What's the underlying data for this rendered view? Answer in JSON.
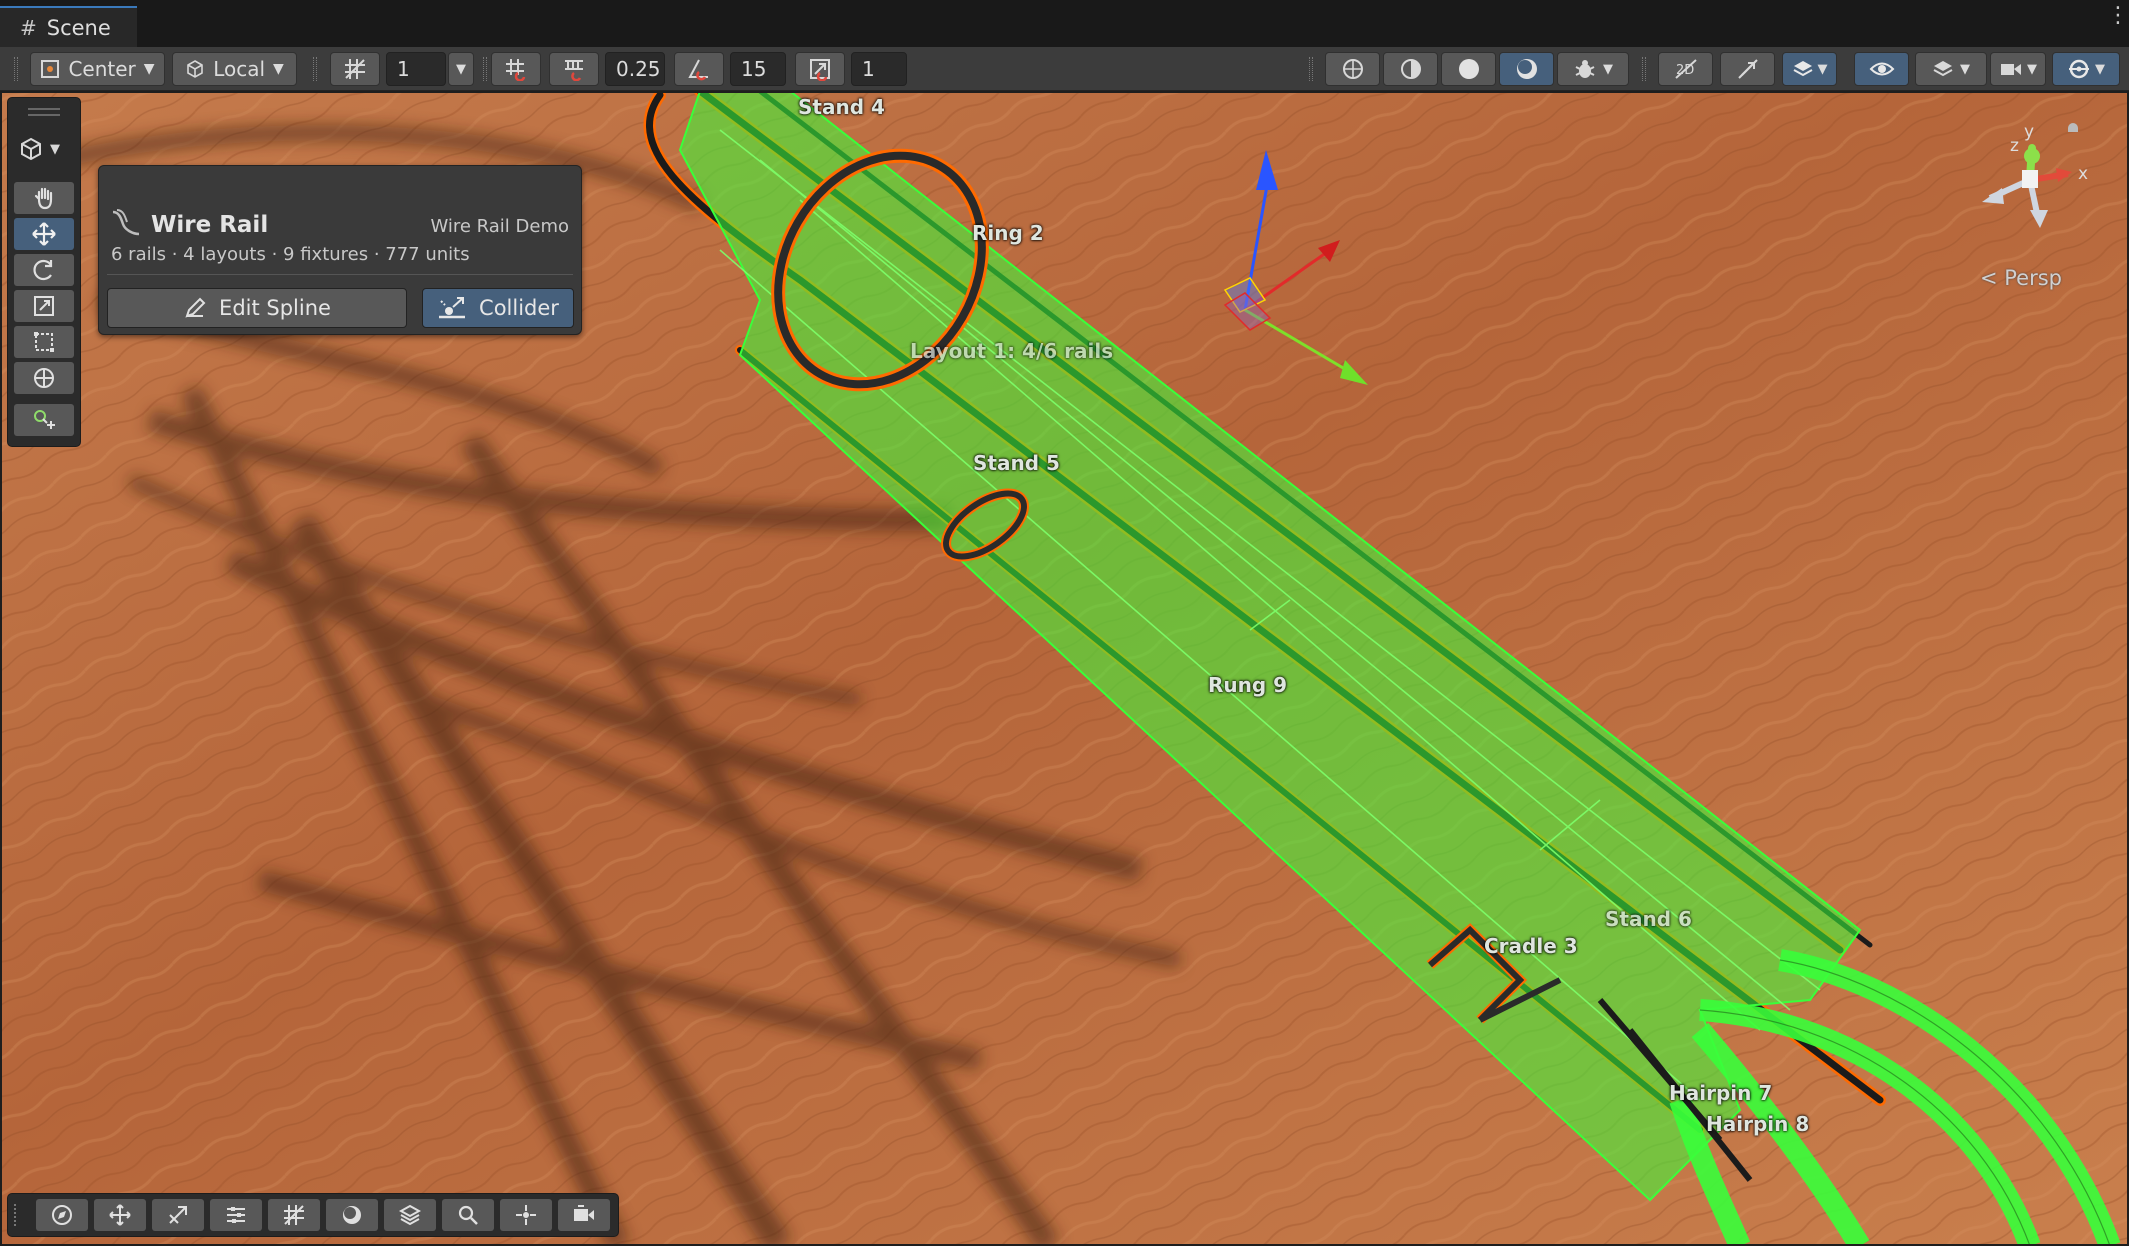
{
  "tab": {
    "title": "Scene"
  },
  "toolbar": {
    "pivot_mode": "Center",
    "pivot_rotation": "Local",
    "grid_snap_value": "1",
    "increment_snap_value": "0.25",
    "rotation_snap_value": "15",
    "scale_snap_value": "1"
  },
  "overlay": {
    "title": "Wire Rail",
    "subtitle": "Wire Rail Demo",
    "stats": "6 rails  ·  4 layouts  ·  9 fixtures  ·  777 units",
    "edit_spline_label": "Edit Spline",
    "collider_label": "Collider"
  },
  "scene_labels": {
    "stand4": "Stand 4",
    "ring2": "Ring 2",
    "layout1": "Layout 1: 4/6 rails",
    "stand5": "Stand 5",
    "rung9": "Rung 9",
    "stand6": "Stand 6",
    "cradle3": "Cradle 3",
    "hairpin7": "Hairpin 7",
    "hairpin8": "Hairpin 8"
  },
  "gizmo": {
    "persp_label": "< Persp",
    "axis_x": "x",
    "axis_y": "y",
    "axis_z": "z"
  },
  "colors": {
    "accent": "#46607c",
    "selection_green": "#39ff3a",
    "outline_orange": "#ff6a00",
    "wood": "#b9683a"
  }
}
